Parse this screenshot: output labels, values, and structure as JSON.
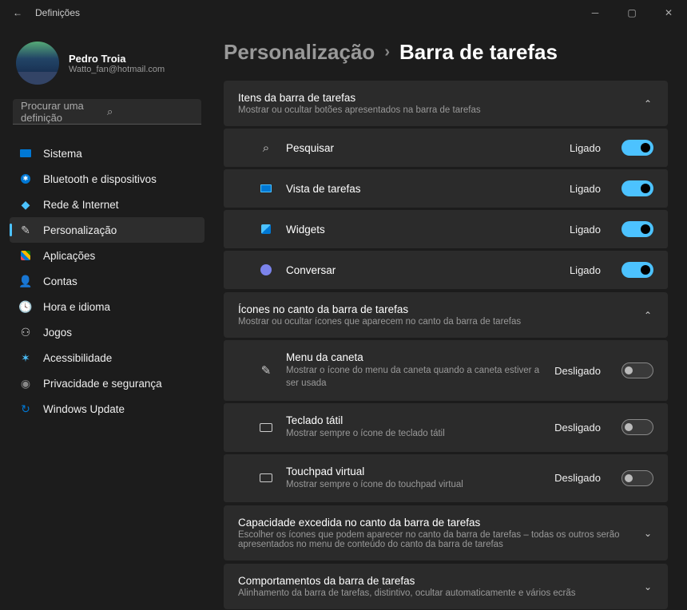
{
  "window": {
    "title": "Definições"
  },
  "profile": {
    "name": "Pedro Troia",
    "email": "Watto_fan@hotmail.com"
  },
  "search": {
    "placeholder": "Procurar uma definição"
  },
  "nav": [
    {
      "label": "Sistema",
      "icon": "🖥️"
    },
    {
      "label": "Bluetooth e dispositivos",
      "icon": "ble"
    },
    {
      "label": "Rede & Internet",
      "icon": "wifi"
    },
    {
      "label": "Personalização",
      "icon": "✏️",
      "active": true
    },
    {
      "label": "Aplicações",
      "icon": "▦"
    },
    {
      "label": "Contas",
      "icon": "👤"
    },
    {
      "label": "Hora e idioma",
      "icon": "🌐"
    },
    {
      "label": "Jogos",
      "icon": "🎮"
    },
    {
      "label": "Acessibilidade",
      "icon": "acc"
    },
    {
      "label": "Privacidade e segurança",
      "icon": "🛡️"
    },
    {
      "label": "Windows Update",
      "icon": "🔄"
    }
  ],
  "breadcrumb": {
    "root": "Personalização",
    "page": "Barra de tarefas"
  },
  "sections": {
    "items": {
      "title": "Itens da barra de tarefas",
      "subtitle": "Mostrar ou ocultar botões apresentados na barra de tarefas",
      "rows": [
        {
          "label": "Pesquisar",
          "state": "Ligado",
          "on": true
        },
        {
          "label": "Vista de tarefas",
          "state": "Ligado",
          "on": true
        },
        {
          "label": "Widgets",
          "state": "Ligado",
          "on": true
        },
        {
          "label": "Conversar",
          "state": "Ligado",
          "on": true
        }
      ]
    },
    "corner": {
      "title": "Ícones no canto da barra de tarefas",
      "subtitle": "Mostrar ou ocultar ícones que aparecem no canto da barra de tarefas",
      "rows": [
        {
          "label": "Menu da caneta",
          "desc": "Mostrar o ícone do menu da caneta quando a caneta estiver a ser usada",
          "state": "Desligado",
          "on": false
        },
        {
          "label": "Teclado tátil",
          "desc": "Mostrar sempre o ícone de teclado tátil",
          "state": "Desligado",
          "on": false
        },
        {
          "label": "Touchpad virtual",
          "desc": "Mostrar sempre o ícone do touchpad virtual",
          "state": "Desligado",
          "on": false
        }
      ]
    },
    "overflow": {
      "title": "Capacidade excedida no canto da barra de tarefas",
      "subtitle": "Escolher os ícones que podem aparecer no canto da barra de tarefas – todas os outros serão apresentados no menu de conteúdo do canto da barra de tarefas"
    },
    "behaviors": {
      "title": "Comportamentos da barra de tarefas",
      "subtitle": "Alinhamento da barra de tarefas, distintivo, ocultar automaticamente e vários ecrãs"
    }
  }
}
